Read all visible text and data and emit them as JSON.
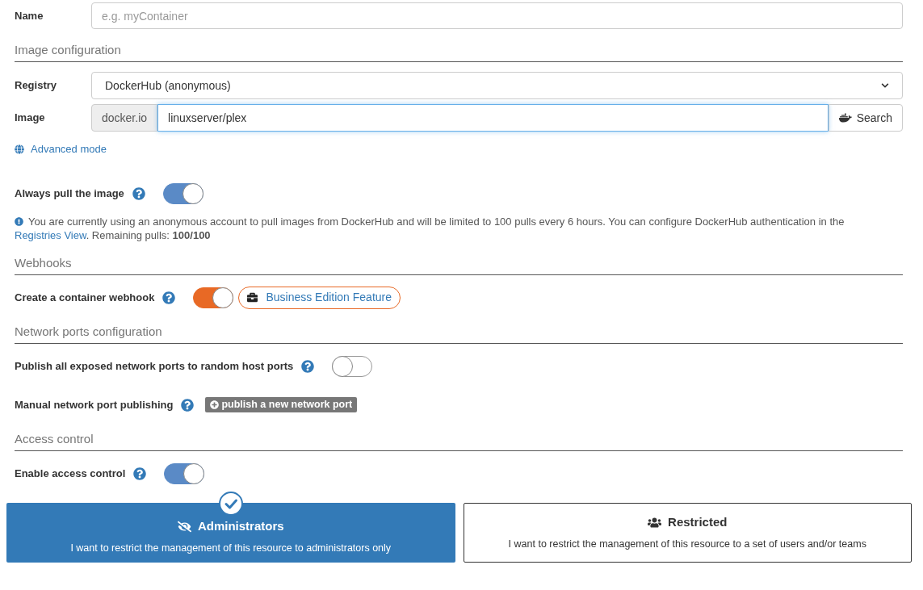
{
  "name_field": {
    "label": "Name",
    "placeholder": "e.g. myContainer"
  },
  "image_section": {
    "title": "Image configuration",
    "registry": {
      "label": "Registry",
      "value": "DockerHub (anonymous)"
    },
    "image": {
      "label": "Image",
      "prefix": "docker.io",
      "value": "linuxserver/plex",
      "button": "Search"
    },
    "advanced_link": "Advanced mode",
    "always_pull": {
      "label": "Always pull the image",
      "on": true
    },
    "notice": "You are currently using an anonymous account to pull images from DockerHub and will be limited to 100 pulls every 6 hours. You can configure DockerHub authentication in the",
    "notice_link": "Registries View",
    "notice_tail": ". Remaining pulls: **100/100**"
  },
  "webhooks_section": {
    "title": "Webhooks",
    "toggle": {
      "label": "Create a container webhook",
      "on": true,
      "kind": "business"
    },
    "badge": "Business Edition Feature"
  },
  "ports_section": {
    "title": "Network ports configuration",
    "toggle": {
      "label": "Publish all exposed network ports to random host ports",
      "on": false
    },
    "manual_label": "Manual network port publishing",
    "manual_button": "publish a new network port"
  },
  "access_section": {
    "title": "Access control",
    "toggle": {
      "label": "Enable access control",
      "on": true
    },
    "options": [
      {
        "title": "Administrators",
        "description": "I want to restrict the management of this resource to administrators only",
        "selected": true
      },
      {
        "title": "Restricted",
        "description": "I want to restrict the management of this resource to a set of users and/or teams",
        "selected": false
      }
    ]
  }
}
